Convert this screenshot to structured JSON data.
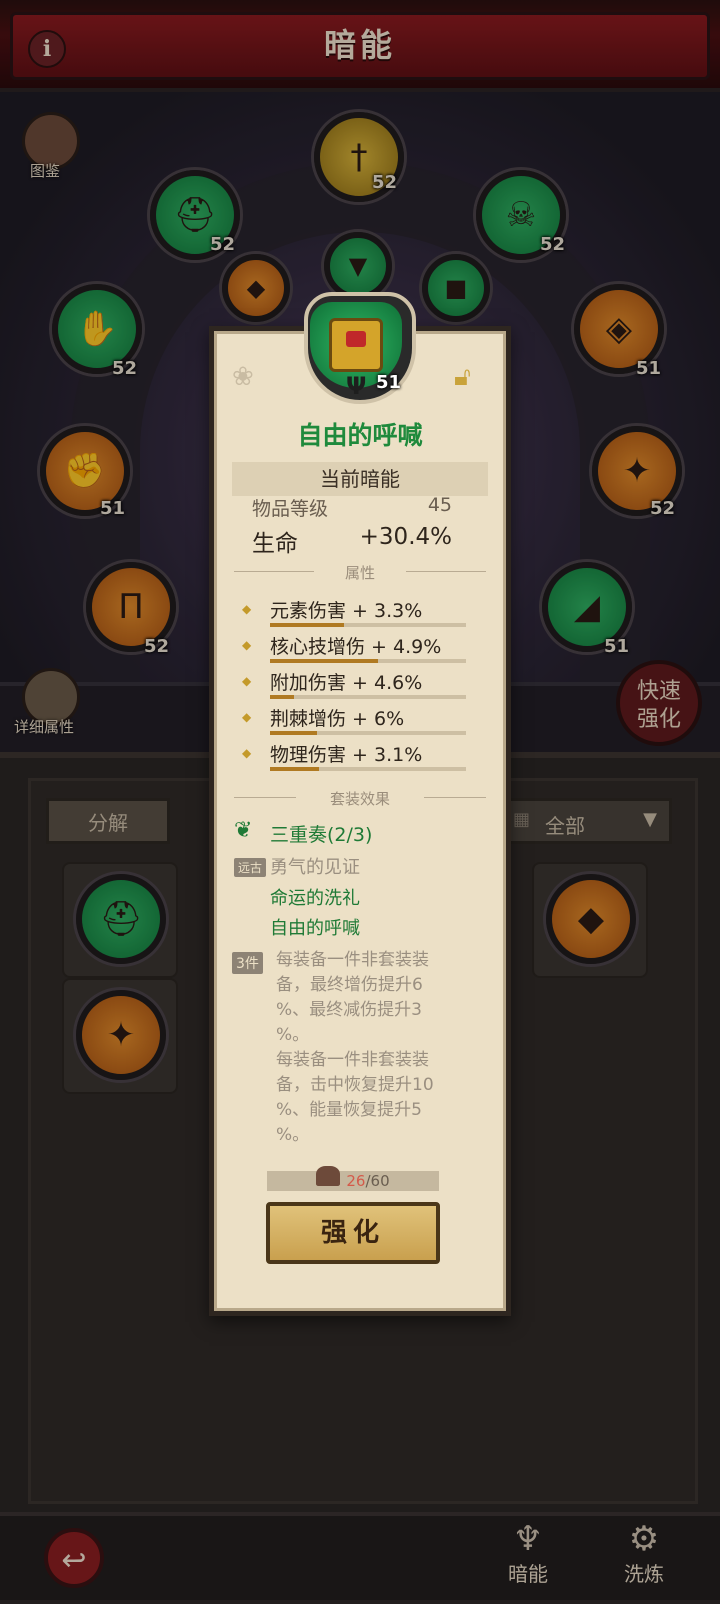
{
  "header": {
    "title": "暗能",
    "info_icon": "i"
  },
  "side": {
    "codex_label": "图鉴",
    "detail_label": "详细属性",
    "quick_label": "快速强化"
  },
  "badges": [
    {
      "level": "52",
      "color": "gold"
    },
    {
      "level": "52",
      "color": "green"
    },
    {
      "level": "52",
      "color": "green"
    },
    {
      "level": "51",
      "color": "orange"
    },
    {
      "level": "51",
      "color": "green"
    },
    {
      "level": "51",
      "color": "green"
    },
    {
      "level": "52",
      "color": "green"
    },
    {
      "level": "51",
      "color": "orange"
    },
    {
      "level": "51",
      "color": "orange"
    },
    {
      "level": "52",
      "color": "orange"
    },
    {
      "level": "52",
      "color": "orange"
    },
    {
      "level": "51",
      "color": "green"
    }
  ],
  "inventory": {
    "decompose_label": "分解",
    "filter_label": "全部"
  },
  "popup": {
    "item_level": "51",
    "item_name": "自由的呼喊",
    "current_section": "当前暗能",
    "item_level_label": "物品等级",
    "item_level_value": "45",
    "main_stat_label": "生命",
    "main_stat_value": "+30.4%",
    "attr_header": "属性",
    "attributes": [
      {
        "text": "元素伤害 + 3.3%",
        "fill_percent": 38
      },
      {
        "text": "核心技增伤 + 4.9%",
        "fill_percent": 55
      },
      {
        "text": "附加伤害 + 4.6%",
        "fill_percent": 12
      },
      {
        "text": "荆棘增伤 + 6%",
        "fill_percent": 24
      },
      {
        "text": "物理伤害 + 3.1%",
        "fill_percent": 25
      }
    ],
    "set_header": "套装效果",
    "set_name": "三重奏(2/3)",
    "set_items": [
      {
        "tag": "远古",
        "name": "勇气的见证",
        "owned": false
      },
      {
        "tag": "",
        "name": "命运的洗礼",
        "owned": true
      },
      {
        "tag": "",
        "name": "自由的呼喊",
        "owned": true
      }
    ],
    "set_bonus_tag": "3件",
    "set_bonus_lines": [
      "每装备一件非套装装",
      "备，最终增伤提升6",
      "%、最终减伤提升3",
      "%。",
      "每装备一件非套装装",
      "备，击中恢复提升10",
      "%、能量恢复提升5",
      "%。"
    ],
    "material_current": "26",
    "material_total": "/60",
    "enhance_label": "强化"
  },
  "bottom_nav": {
    "tab_dark_energy": "暗能",
    "tab_refine": "洗炼",
    "back_icon": "↩"
  },
  "colors": {
    "accent_green": "#1f8a3c",
    "header_red": "#8a1a1f",
    "card_bg": "#ece0c6"
  }
}
